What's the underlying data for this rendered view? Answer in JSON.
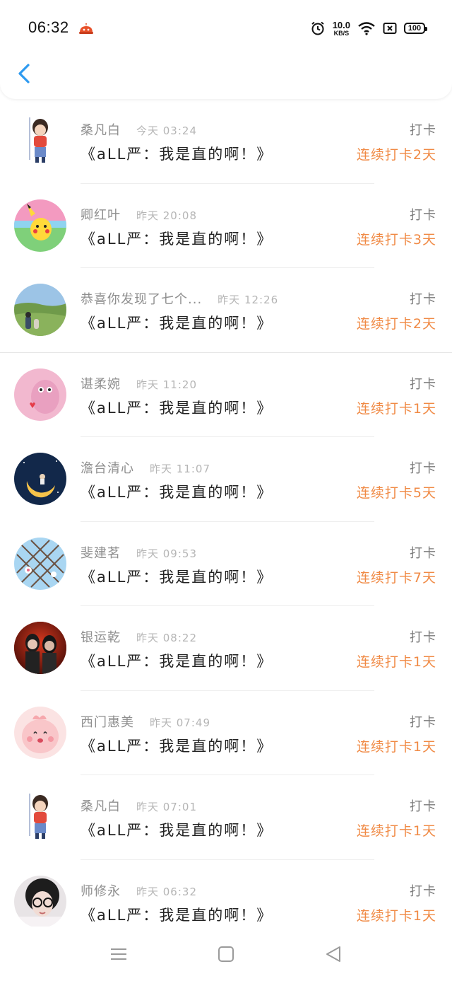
{
  "status_bar": {
    "time": "06:32",
    "net_speed_value": "10.0",
    "net_speed_unit": "KB/S",
    "battery": "100",
    "icons": [
      "app-notification-icon",
      "alarm-icon",
      "wifi-icon",
      "sim-x-icon",
      "battery-icon"
    ]
  },
  "header": {
    "back_icon": "chevron-left-icon"
  },
  "rows": [
    {
      "name": "桑凡白",
      "time": "今天 03:24",
      "title": "《aLL严：我是直的啊！》",
      "action": "打卡",
      "streak": "连续打卡2天"
    },
    {
      "name": "卿红叶",
      "time": "昨天 20:08",
      "title": "《aLL严：我是直的啊！》",
      "action": "打卡",
      "streak": "连续打卡3天"
    },
    {
      "name": "恭喜你发现了七个...",
      "time": "昨天 12:26",
      "title": "《aLL严：我是直的啊！》",
      "action": "打卡",
      "streak": "连续打卡2天"
    },
    {
      "name": "谌柔婉",
      "time": "昨天 11:20",
      "title": "《aLL严：我是直的啊！》",
      "action": "打卡",
      "streak": "连续打卡1天"
    },
    {
      "name": "澹台清心",
      "time": "昨天 11:07",
      "title": "《aLL严：我是直的啊！》",
      "action": "打卡",
      "streak": "连续打卡5天"
    },
    {
      "name": "斐建茗",
      "time": "昨天 09:53",
      "title": "《aLL严：我是直的啊！》",
      "action": "打卡",
      "streak": "连续打卡7天"
    },
    {
      "name": "银运乾",
      "time": "昨天 08:22",
      "title": "《aLL严：我是直的啊！》",
      "action": "打卡",
      "streak": "连续打卡1天"
    },
    {
      "name": "西门惠美",
      "time": "昨天 07:49",
      "title": "《aLL严：我是直的啊！》",
      "action": "打卡",
      "streak": "连续打卡1天"
    },
    {
      "name": "桑凡白",
      "time": "昨天 07:01",
      "title": "《aLL严：我是直的啊！》",
      "action": "打卡",
      "streak": "连续打卡1天"
    },
    {
      "name": "师修永",
      "time": "昨天 06:32",
      "title": "《aLL严：我是直的啊！》",
      "action": "打卡",
      "streak": "连续打卡1天"
    }
  ],
  "nav_bar": {
    "icons": [
      "menu-icon",
      "home-icon",
      "back-triangle-icon"
    ]
  },
  "colors": {
    "accent": "#f08a45",
    "name": "#8f8f8f",
    "time": "#b5b5b5",
    "title": "#222222",
    "back_arrow": "#2e9af0"
  }
}
